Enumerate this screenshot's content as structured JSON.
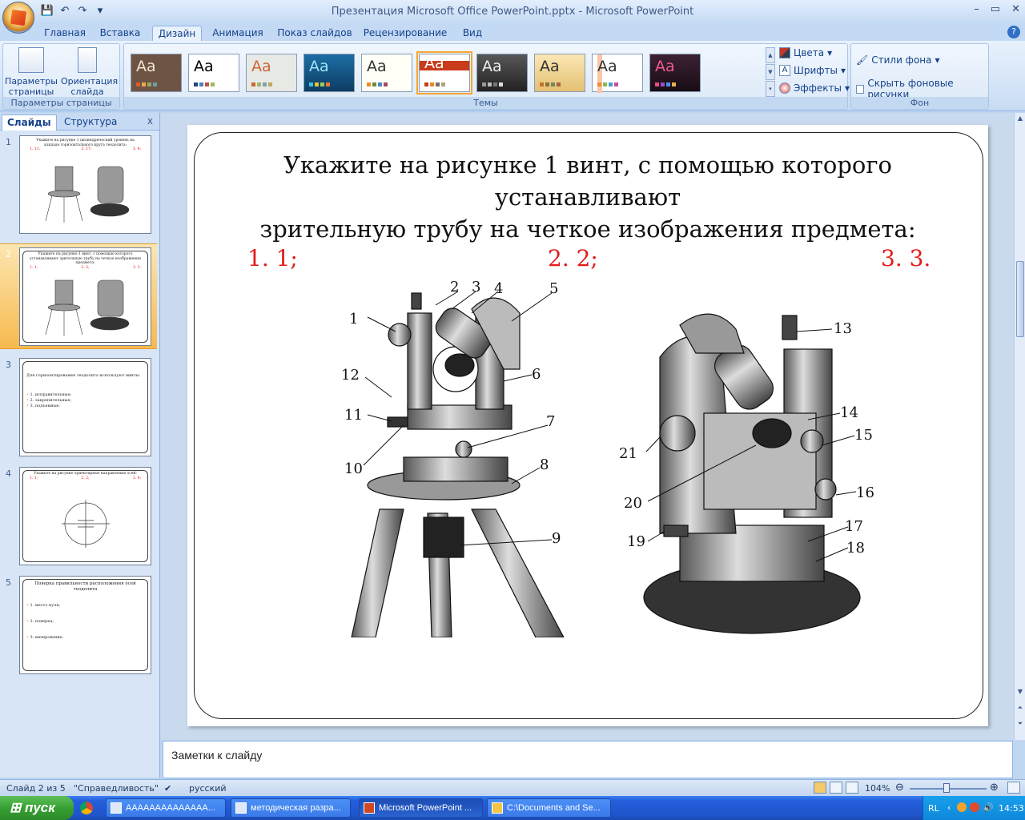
{
  "window": {
    "title": "Презентация Microsoft Office PowerPoint.pptx - Microsoft PowerPoint",
    "controls": [
      "–",
      "▭",
      "✕"
    ]
  },
  "ribbon_tabs": [
    "Главная",
    "Вставка",
    "Дизайн",
    "Анимация",
    "Показ слайдов",
    "Рецензирование",
    "Вид"
  ],
  "active_tab": "Дизайн",
  "ribbon": {
    "page_setup": {
      "btn1": "Параметры страницы",
      "btn2": "Ориентация слайда",
      "group": "Параметры страницы"
    },
    "themes": {
      "group": "Темы",
      "theme_sample": "Aa"
    },
    "theme_options": {
      "colors": "Цвета",
      "fonts": "Шрифты",
      "effects": "Эффекты"
    },
    "background": {
      "styles": "Стили фона",
      "hide": "Скрыть фоновые рисунки",
      "group": "Фон"
    }
  },
  "left_panel": {
    "tab_slides": "Слайды",
    "tab_outline": "Структура",
    "close": "x"
  },
  "thumbnails": [
    {
      "num": "1",
      "title": "Укажите на рисунке 1 цилиндрический уровень на алидаде горизонтального круга теодолита:",
      "opts": [
        "1. 11;",
        "2. 17;",
        "3. 4;"
      ]
    },
    {
      "num": "2",
      "title": "Укажите на рисунке 1 винт, с помощью которого устанавливают зрительную трубу на четкое изображения предмета:",
      "opts": [
        "1. 1;",
        "2. 2;",
        "3. 3."
      ]
    },
    {
      "num": "3",
      "title": "Для горизонтирования теодолита используют винты:",
      "items": [
        "1. исправительные;",
        "2. закрепительные;",
        "3. подъемные."
      ]
    },
    {
      "num": "4",
      "title": "Укажите на рисунке ориентирные направления осей:",
      "opts": [
        "1. 1;",
        "2. 2;",
        "3. 4;"
      ]
    },
    {
      "num": "5",
      "title": "Поверка правильности расположения осей теодолита",
      "items": [
        "1. место нуля;",
        "2. поверка;",
        "3. визирование."
      ]
    }
  ],
  "slide": {
    "title_line1": "Укажите на рисунке 1 винт, с помощью которого",
    "title_line2": "устанавливают",
    "title_line3": "зрительную трубу на четкое изображения предмета:",
    "options": [
      "1. 1;",
      "2. 2;",
      "3. 3."
    ],
    "left_labels": [
      "1",
      "2",
      "3",
      "4",
      "5",
      "6",
      "7",
      "8",
      "9",
      "10",
      "11",
      "12"
    ],
    "right_labels": [
      "13",
      "14",
      "15",
      "16",
      "17",
      "18",
      "19",
      "20",
      "21"
    ]
  },
  "notes": {
    "placeholder": "Заметки к слайду"
  },
  "status": {
    "slide_info": "Слайд 2 из 5",
    "theme": "\"Справедливость\"",
    "language": "русский",
    "zoom": "104%"
  },
  "taskbar": {
    "start": "пуск",
    "tasks": [
      "АААААААААААААА...",
      "методическая разра...",
      "Microsoft PowerPoint ...",
      "C:\\Documents and Se..."
    ],
    "lang": "RL",
    "clock": "14:53"
  },
  "colors": {
    "option_red": "#e41a1a",
    "ribbon_blue": "#15428b"
  }
}
